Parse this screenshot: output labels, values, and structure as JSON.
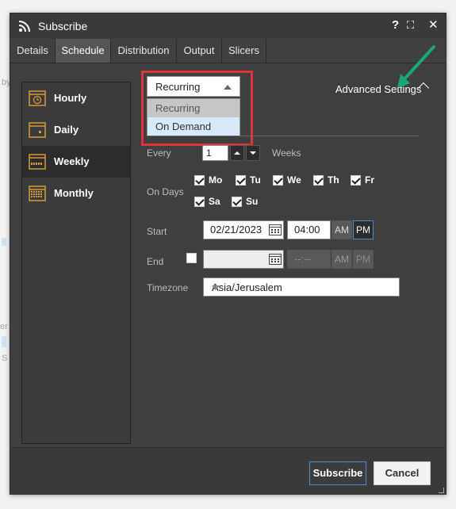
{
  "title": "Subscribe",
  "titlebar": {
    "help": "?",
    "expand": "⛶",
    "close": "✕"
  },
  "tabs": [
    "Details",
    "Schedule",
    "Distribution",
    "Output",
    "Slicers"
  ],
  "sidebar": [
    {
      "label": "Hourly",
      "icon": "clock-icon"
    },
    {
      "label": "Daily",
      "icon": "calendar-day-icon"
    },
    {
      "label": "Weekly",
      "icon": "calendar-week-icon"
    },
    {
      "label": "Monthly",
      "icon": "calendar-month-icon"
    }
  ],
  "dropdown": {
    "value": "Recurring",
    "options": [
      "Recurring",
      "On Demand"
    ]
  },
  "advanced_settings": "Advanced Settings",
  "every": {
    "label": "Every",
    "value": "1",
    "unit": "Weeks"
  },
  "on_days": {
    "label": "On Days",
    "days": [
      "Mo",
      "Tu",
      "We",
      "Th",
      "Fr",
      "Sa",
      "Su"
    ]
  },
  "start": {
    "label": "Start",
    "date": "02/21/2023",
    "time": "04:00",
    "am": "AM",
    "pm": "PM"
  },
  "end": {
    "label": "End",
    "time": "--:--",
    "am": "AM",
    "pm": "PM"
  },
  "timezone": {
    "label": "Timezone",
    "value": "Asia/Jerusalem"
  },
  "footer": {
    "subscribe": "Subscribe",
    "cancel": "Cancel"
  },
  "colors": {
    "accent": "#4a8fd6",
    "highlight_box": "#e1343a",
    "annotation_arrow": "#1aa57a"
  }
}
